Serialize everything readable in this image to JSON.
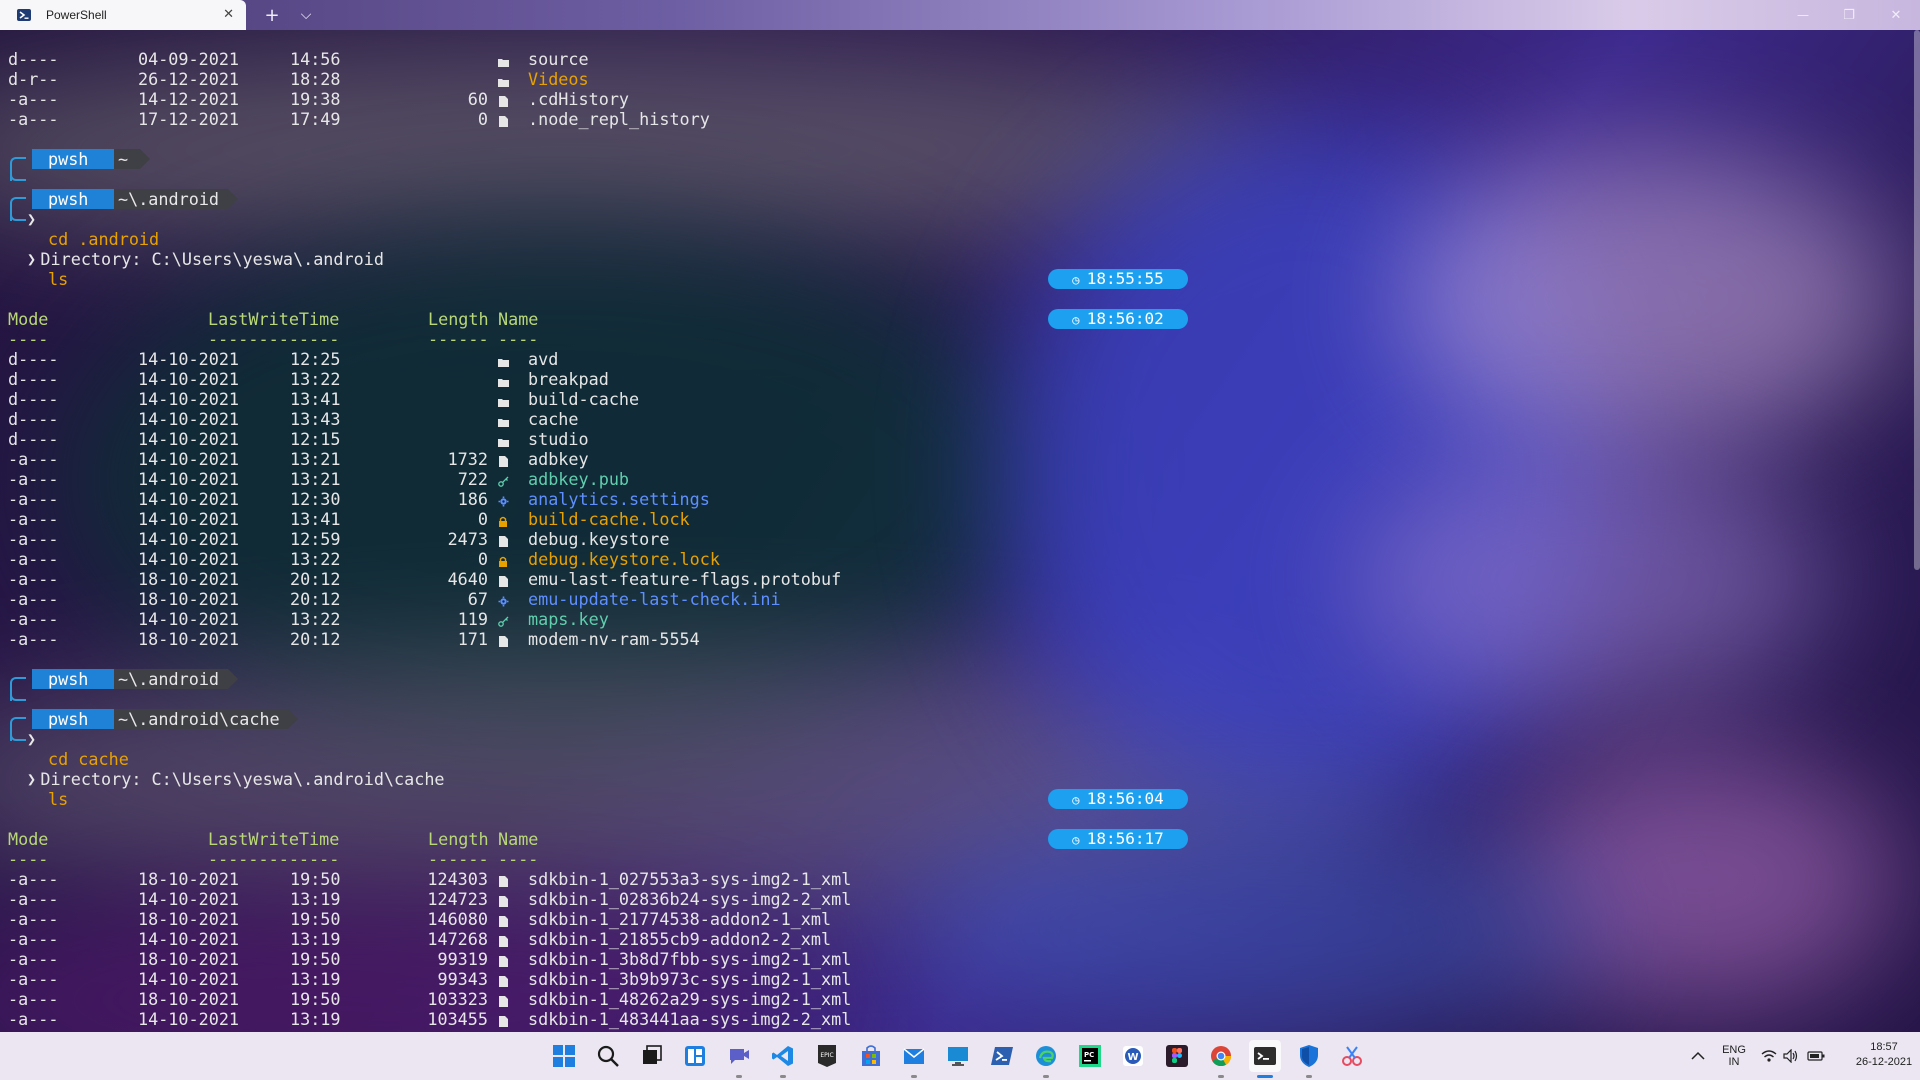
{
  "window": {
    "tab_title": "PowerShell",
    "tab_close": "✕",
    "new_tab": "+",
    "dropdown": "⌵",
    "minimize": "—",
    "restore": "❐",
    "close": "✕"
  },
  "top_listing": [
    {
      "mode": "d----",
      "date": "04-09-2021",
      "time": "14:56",
      "length": "",
      "icon": "folder-icon",
      "name": "source",
      "color": "default"
    },
    {
      "mode": "d-r--",
      "date": "26-12-2021",
      "time": "18:28",
      "length": "",
      "icon": "folder-icon",
      "name": "Videos",
      "color": "yellow"
    },
    {
      "mode": "-a---",
      "date": "14-12-2021",
      "time": "19:38",
      "length": "60",
      "icon": "file-icon",
      "name": ".cdHistory",
      "color": "default"
    },
    {
      "mode": "-a---",
      "date": "17-12-2021",
      "time": "17:49",
      "length": "0",
      "icon": "file-icon",
      "name": ".node_repl_history",
      "color": "default"
    }
  ],
  "prompts": [
    {
      "shell": "pwsh",
      "path": "~",
      "time": "18:55:55",
      "command": "cd .android"
    },
    {
      "shell": "pwsh",
      "path": "~\\.android",
      "time": "18:56:02",
      "command": "ls"
    },
    {
      "shell": "pwsh",
      "path": "~\\.android",
      "time": "18:56:04",
      "command": "cd cache"
    },
    {
      "shell": "pwsh",
      "path": "~\\.android\\cache",
      "time": "18:56:17",
      "command": "ls"
    }
  ],
  "listing1": {
    "directory": "    Directory: C:\\Users\\yeswa\\.android",
    "headers": {
      "mode": "Mode",
      "lwt": "LastWriteTime",
      "length": "Length",
      "name": "Name"
    },
    "underline": {
      "mode": "----",
      "lwt": "-------------",
      "length": "------",
      "name": "----"
    },
    "rows": [
      {
        "mode": "d----",
        "date": "14-10-2021",
        "time": "12:25",
        "length": "",
        "icon": "folder-icon",
        "name": "avd",
        "color": "default"
      },
      {
        "mode": "d----",
        "date": "14-10-2021",
        "time": "13:22",
        "length": "",
        "icon": "folder-icon",
        "name": "breakpad",
        "color": "default"
      },
      {
        "mode": "d----",
        "date": "14-10-2021",
        "time": "13:41",
        "length": "",
        "icon": "folder-icon",
        "name": "build-cache",
        "color": "default"
      },
      {
        "mode": "d----",
        "date": "14-10-2021",
        "time": "13:43",
        "length": "",
        "icon": "folder-icon",
        "name": "cache",
        "color": "default"
      },
      {
        "mode": "d----",
        "date": "14-10-2021",
        "time": "12:15",
        "length": "",
        "icon": "folder-icon",
        "name": "studio",
        "color": "default"
      },
      {
        "mode": "-a---",
        "date": "14-10-2021",
        "time": "13:21",
        "length": "1732",
        "icon": "file-icon",
        "name": "adbkey",
        "color": "default"
      },
      {
        "mode": "-a---",
        "date": "14-10-2021",
        "time": "13:21",
        "length": "722",
        "icon": "key-icon",
        "name": "adbkey.pub",
        "color": "teal"
      },
      {
        "mode": "-a---",
        "date": "14-10-2021",
        "time": "12:30",
        "length": "186",
        "icon": "gear-icon",
        "name": "analytics.settings",
        "color": "blue"
      },
      {
        "mode": "-a---",
        "date": "14-10-2021",
        "time": "13:41",
        "length": "0",
        "icon": "lock-icon",
        "name": "build-cache.lock",
        "color": "yellow"
      },
      {
        "mode": "-a---",
        "date": "14-10-2021",
        "time": "12:59",
        "length": "2473",
        "icon": "file-icon",
        "name": "debug.keystore",
        "color": "default"
      },
      {
        "mode": "-a---",
        "date": "14-10-2021",
        "time": "13:22",
        "length": "0",
        "icon": "lock-icon",
        "name": "debug.keystore.lock",
        "color": "yellow"
      },
      {
        "mode": "-a---",
        "date": "18-10-2021",
        "time": "20:12",
        "length": "4640",
        "icon": "file-icon",
        "name": "emu-last-feature-flags.protobuf",
        "color": "default"
      },
      {
        "mode": "-a---",
        "date": "18-10-2021",
        "time": "20:12",
        "length": "67",
        "icon": "gear-icon",
        "name": "emu-update-last-check.ini",
        "color": "blue"
      },
      {
        "mode": "-a---",
        "date": "14-10-2021",
        "time": "13:22",
        "length": "119",
        "icon": "key-icon",
        "name": "maps.key",
        "color": "teal"
      },
      {
        "mode": "-a---",
        "date": "18-10-2021",
        "time": "20:12",
        "length": "171",
        "icon": "file-icon",
        "name": "modem-nv-ram-5554",
        "color": "default"
      }
    ]
  },
  "listing2": {
    "directory": "    Directory: C:\\Users\\yeswa\\.android\\cache",
    "headers": {
      "mode": "Mode",
      "lwt": "LastWriteTime",
      "length": "Length",
      "name": "Name"
    },
    "underline": {
      "mode": "----",
      "lwt": "-------------",
      "length": "------",
      "name": "----"
    },
    "rows": [
      {
        "mode": "-a---",
        "date": "18-10-2021",
        "time": "19:50",
        "length": "124303",
        "icon": "file-icon",
        "name": "sdkbin-1_027553a3-sys-img2-1_xml",
        "color": "default"
      },
      {
        "mode": "-a---",
        "date": "14-10-2021",
        "time": "13:19",
        "length": "124723",
        "icon": "file-icon",
        "name": "sdkbin-1_02836b24-sys-img2-2_xml",
        "color": "default"
      },
      {
        "mode": "-a---",
        "date": "18-10-2021",
        "time": "19:50",
        "length": "146080",
        "icon": "file-icon",
        "name": "sdkbin-1_21774538-addon2-1_xml",
        "color": "default"
      },
      {
        "mode": "-a---",
        "date": "14-10-2021",
        "time": "13:19",
        "length": "147268",
        "icon": "file-icon",
        "name": "sdkbin-1_21855cb9-addon2-2_xml",
        "color": "default"
      },
      {
        "mode": "-a---",
        "date": "18-10-2021",
        "time": "19:50",
        "length": "99319",
        "icon": "file-icon",
        "name": "sdkbin-1_3b8d7fbb-sys-img2-1_xml",
        "color": "default"
      },
      {
        "mode": "-a---",
        "date": "14-10-2021",
        "time": "13:19",
        "length": "99343",
        "icon": "file-icon",
        "name": "sdkbin-1_3b9b973c-sys-img2-1_xml",
        "color": "default"
      },
      {
        "mode": "-a---",
        "date": "18-10-2021",
        "time": "19:50",
        "length": "103323",
        "icon": "file-icon",
        "name": "sdkbin-1_48262a29-sys-img2-1_xml",
        "color": "default"
      },
      {
        "mode": "-a---",
        "date": "14-10-2021",
        "time": "13:19",
        "length": "103455",
        "icon": "file-icon",
        "name": "sdkbin-1_483441aa-sys-img2-2_xml",
        "color": "default"
      }
    ]
  },
  "taskbar": {
    "apps": [
      "start-icon",
      "search-icon",
      "task-view-icon",
      "widgets-icon",
      "chat-icon",
      "vscode-icon",
      "epic-games-icon",
      "store-icon",
      "mail-icon",
      "remote-desktop-icon",
      "powershell-icon",
      "edge-icon",
      "pycharm-icon",
      "word-icon",
      "figma-icon",
      "chrome-icon",
      "terminal-icon",
      "defender-icon",
      "snipping-tool-icon"
    ],
    "lang_top": "ENG",
    "lang_bottom": "IN",
    "clock_time": "18:57",
    "clock_date": "26-12-2021"
  },
  "colors": {
    "accent_blue": "#1f82d6",
    "clock_pill": "#1ea0f0",
    "header_green": "#b9d777",
    "yellow": "#e8a200",
    "teal": "#5fcfae",
    "link_blue": "#5f8fff"
  }
}
